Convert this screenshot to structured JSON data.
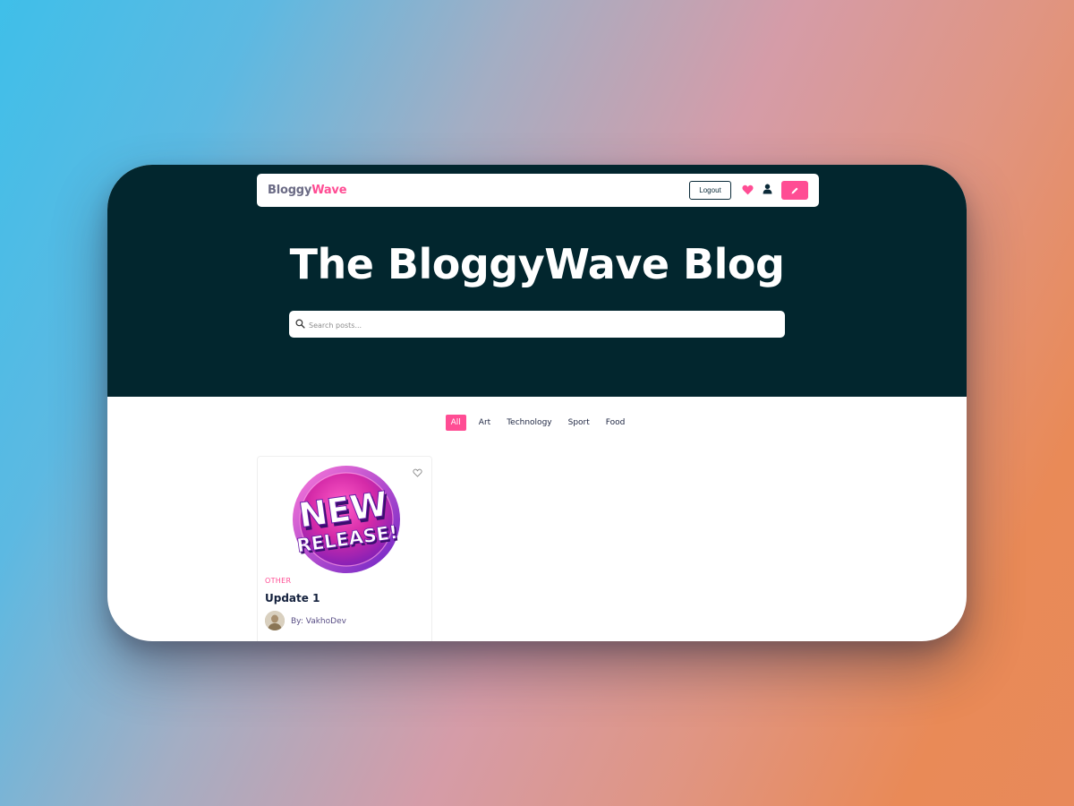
{
  "navbar": {
    "brand_primary": "Bloggy",
    "brand_accent": "Wave",
    "logout_label": "Logout",
    "icons": [
      "heart-icon",
      "user-icon",
      "pencil-icon"
    ]
  },
  "hero": {
    "title": "The BloggyWave Blog"
  },
  "search": {
    "placeholder": "Search posts...",
    "value": ""
  },
  "filters": {
    "items": [
      "All",
      "Art",
      "Technology",
      "Sport",
      "Food"
    ],
    "active": "All"
  },
  "posts": [
    {
      "image_text_line1": "NEW",
      "image_text_line2": "RELEASE!",
      "category": "OTHER",
      "title": "Update 1",
      "author": "By: VakhoDev"
    }
  ],
  "colors": {
    "accent": "#ff4d94",
    "hero_bg": "#02262e",
    "title_text": "#14213d",
    "author_text": "#5a4f86"
  }
}
